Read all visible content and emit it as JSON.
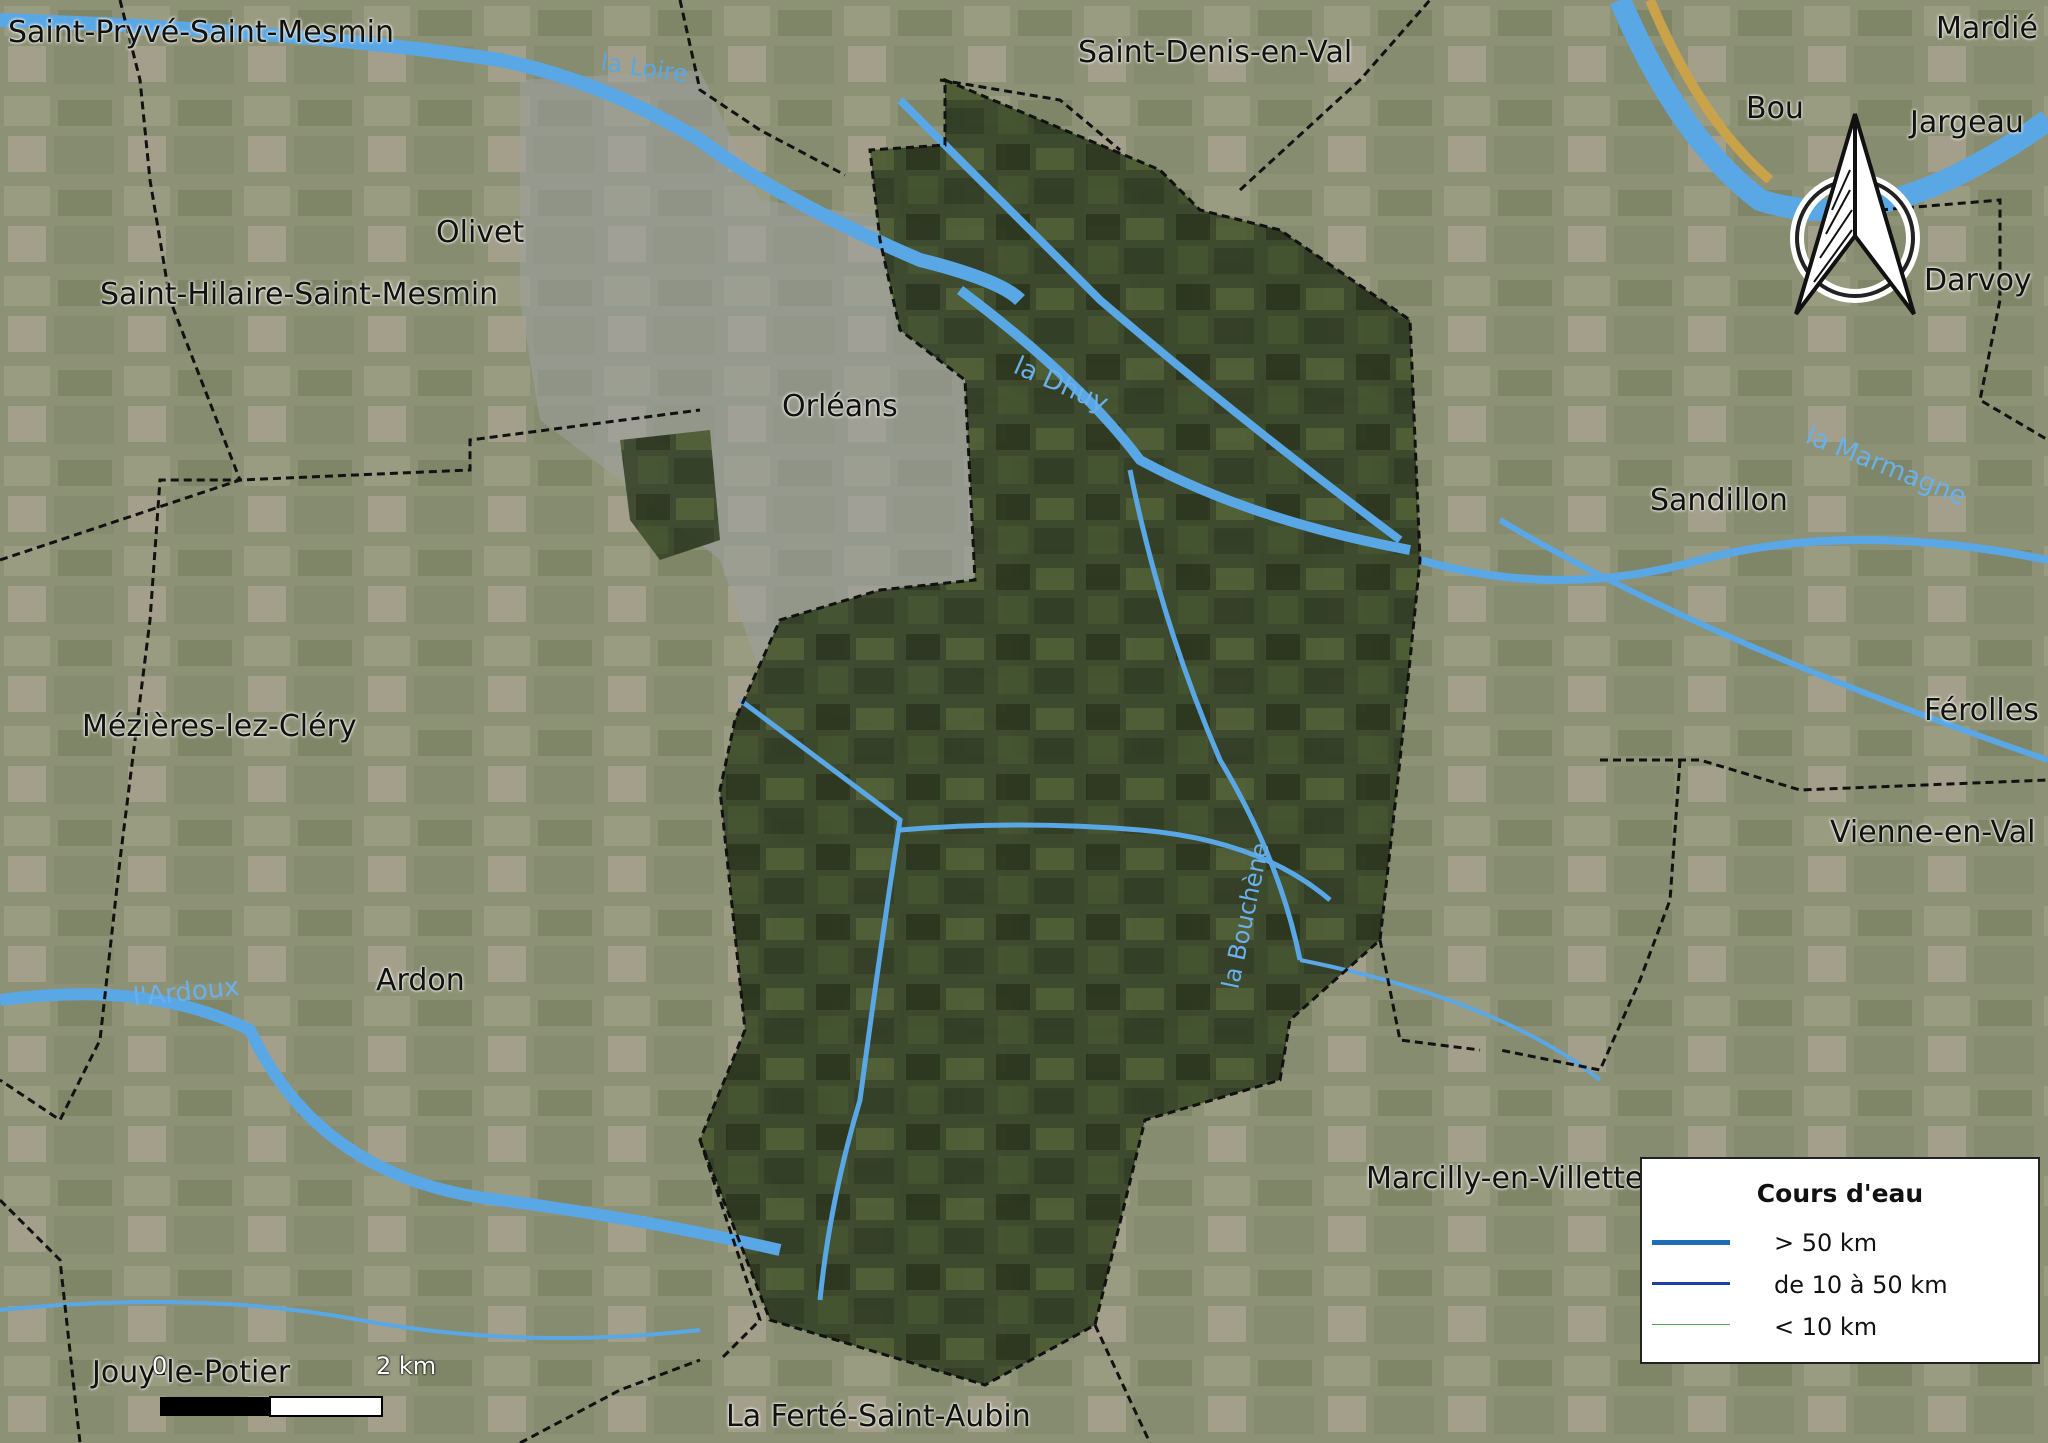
{
  "places": [
    {
      "id": "saint-pryve",
      "name": "Saint-Pryvé-Saint-Mesmin"
    },
    {
      "id": "saint-denis",
      "name": "Saint-Denis-en-Val"
    },
    {
      "id": "mardie",
      "name": "Mardié"
    },
    {
      "id": "bou",
      "name": "Bou"
    },
    {
      "id": "jargeau",
      "name": "Jargeau"
    },
    {
      "id": "olivet",
      "name": "Olivet"
    },
    {
      "id": "saint-hilaire",
      "name": "Saint-Hilaire-Saint-Mesmin"
    },
    {
      "id": "darvoy",
      "name": "Darvoy"
    },
    {
      "id": "orleans",
      "name": "Orléans"
    },
    {
      "id": "sandillon",
      "name": "Sandillon"
    },
    {
      "id": "mezieres",
      "name": "Mézières-lez-Cléry"
    },
    {
      "id": "ferolles",
      "name": "Férolles"
    },
    {
      "id": "vienne",
      "name": "Vienne-en-Val"
    },
    {
      "id": "ardon",
      "name": "Ardon"
    },
    {
      "id": "marcilly",
      "name": "Marcilly-en-Villette"
    },
    {
      "id": "jouy",
      "name": "Jouy-le-Potier"
    },
    {
      "id": "ferte",
      "name": "La Ferté-Saint-Aubin"
    }
  ],
  "rivers": [
    {
      "id": "loire",
      "name": "la Loire"
    },
    {
      "id": "dhuy",
      "name": "la Dhuy"
    },
    {
      "id": "marmagne",
      "name": "la Marmagne"
    },
    {
      "id": "ardoux",
      "name": "l'Ardoux"
    },
    {
      "id": "bouchene",
      "name": "la Bouchène"
    }
  ],
  "legend": {
    "title": "Cours d'eau",
    "items": [
      {
        "label": "> 50 km",
        "color": "#1f6db5",
        "weight": "thick"
      },
      {
        "label": "de 10 à 50 km",
        "color": "#1f3fa3",
        "weight": "medium"
      },
      {
        "label": "< 10 km",
        "color": "#4ea64a",
        "weight": "thin"
      }
    ]
  },
  "scalebar": {
    "start_label": "0",
    "end_label": "2 km"
  },
  "north_arrow": {
    "icon": "north-arrow-icon"
  },
  "colors": {
    "water": "#5aa7e6",
    "boundary": "#111111",
    "highlight": "#2f3a1e",
    "terrain": "#8f9378"
  }
}
